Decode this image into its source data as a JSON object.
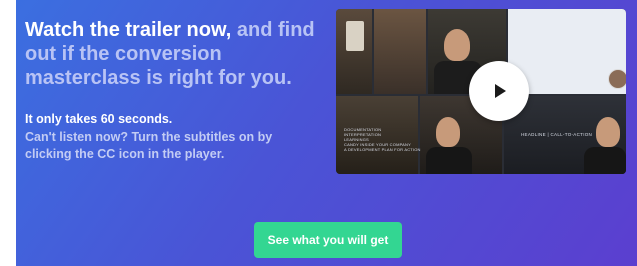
{
  "hero": {
    "headline_strong": "Watch the trailer now,",
    "headline_muted": " and find out if the conversion masterclass is right for you.",
    "subline_strong": "It only takes 60 seconds.",
    "subline_muted": "Can't listen now? Turn the subtitles on by clicking the CC icon in the player."
  },
  "video": {
    "overlay_list": "DOCUMENTATION\nINTERPRETATION\nLEARNINGS\nCANDY INSIDE YOUR COMPANY\nA DEVELOPMENT PLAN FOR ACTION",
    "overlay_caption": "HEADLINE | CALL-TO-ACTION",
    "play_icon": "play-icon"
  },
  "cta": {
    "label": "See what you will get",
    "color": "#33d692"
  },
  "colors": {
    "gradient_start": "#3b6fe0",
    "gradient_end": "#5b3fcf",
    "muted_text": "#b8c3f5"
  }
}
